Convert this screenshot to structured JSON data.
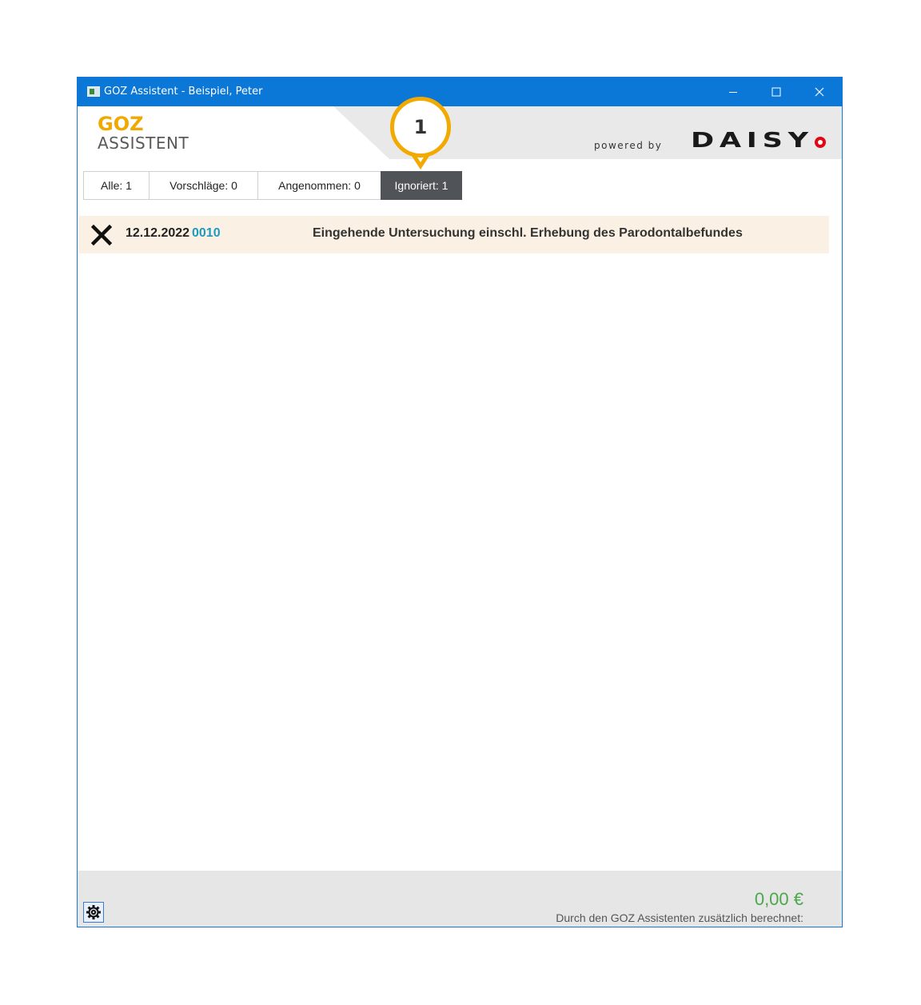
{
  "window": {
    "title": "GOZ Assistent - Beispiel, Peter",
    "controls": {
      "minimize": "minimize-icon",
      "maximize": "maximize-icon",
      "close": "close-icon"
    }
  },
  "header": {
    "logo_line1": "GOZ",
    "logo_line2": "ASSISTENT",
    "powered_by": "powered by",
    "brand": "DAISY"
  },
  "tabs": [
    {
      "label": "Alle: 1",
      "active": false
    },
    {
      "label": "Vorschläge: 0",
      "active": false
    },
    {
      "label": "Angenommen: 0",
      "active": false
    },
    {
      "label": "Ignoriert: 1",
      "active": true
    }
  ],
  "entries": [
    {
      "icon": "ignored-x-icon",
      "date": "12.12.2022",
      "code": "0010",
      "description": "Eingehende Untersuchung einschl. Erhebung des Parodontalbefundes"
    }
  ],
  "footer": {
    "amount": "0,00 €",
    "label": "Durch den GOZ Assistenten zusätzlich berechnet:",
    "settings_icon": "gear-icon"
  },
  "callout": {
    "number": "1"
  },
  "colors": {
    "titlebar": "#0b78d7",
    "accent_yellow": "#f2a900",
    "active_tab": "#505357",
    "code_blue": "#1f9ac0",
    "amount_green": "#4aa84a",
    "row_bg": "#faf1e4",
    "brand_red": "#e30613"
  }
}
